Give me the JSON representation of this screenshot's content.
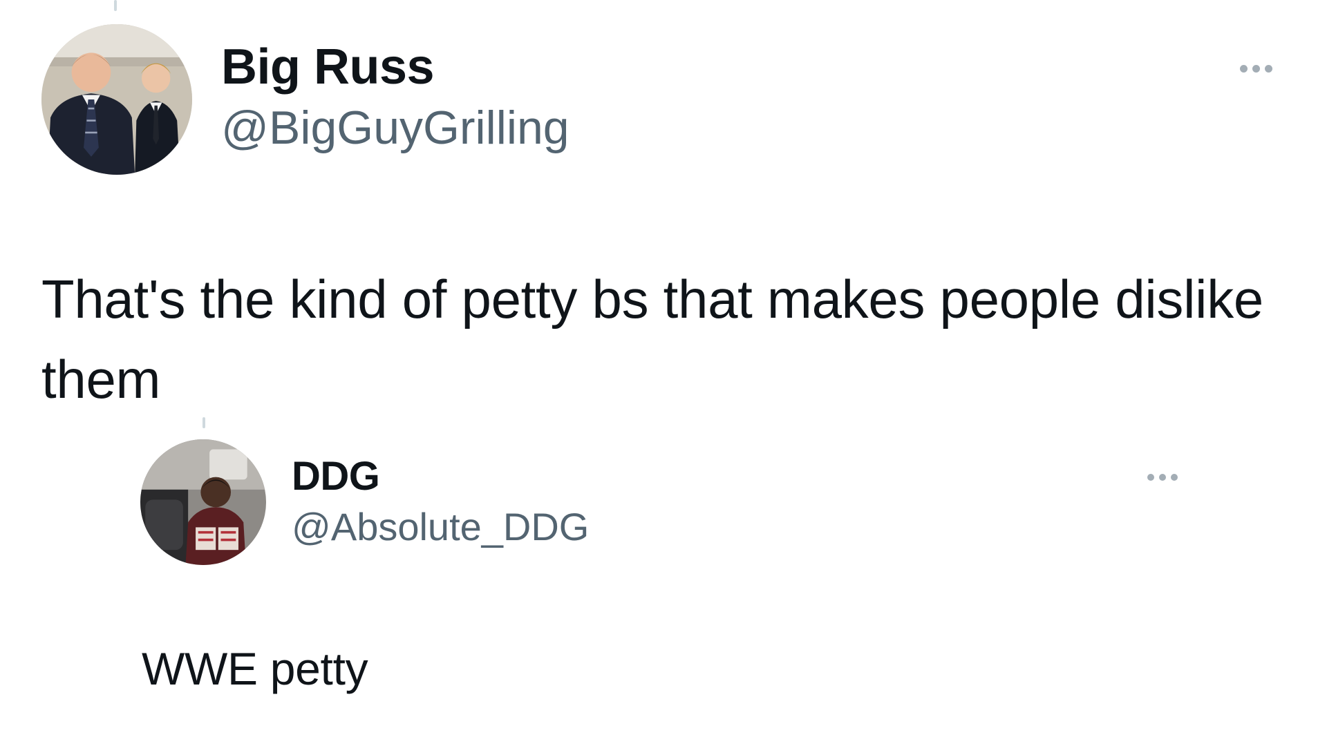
{
  "tweets": [
    {
      "display_name": "Big Russ",
      "handle": "@BigGuyGrilling",
      "text": "That's the kind of petty bs that makes people dislike them",
      "more_icon": "ellipsis-icon"
    },
    {
      "display_name": "DDG",
      "handle": "@Absolute_DDG",
      "text": "WWE petty",
      "more_icon": "ellipsis-icon"
    }
  ],
  "colors": {
    "text_primary": "#0f1419",
    "text_secondary": "#536471",
    "icon_muted": "#a3adb5",
    "thread_line": "#cfd9de",
    "background": "#ffffff"
  }
}
